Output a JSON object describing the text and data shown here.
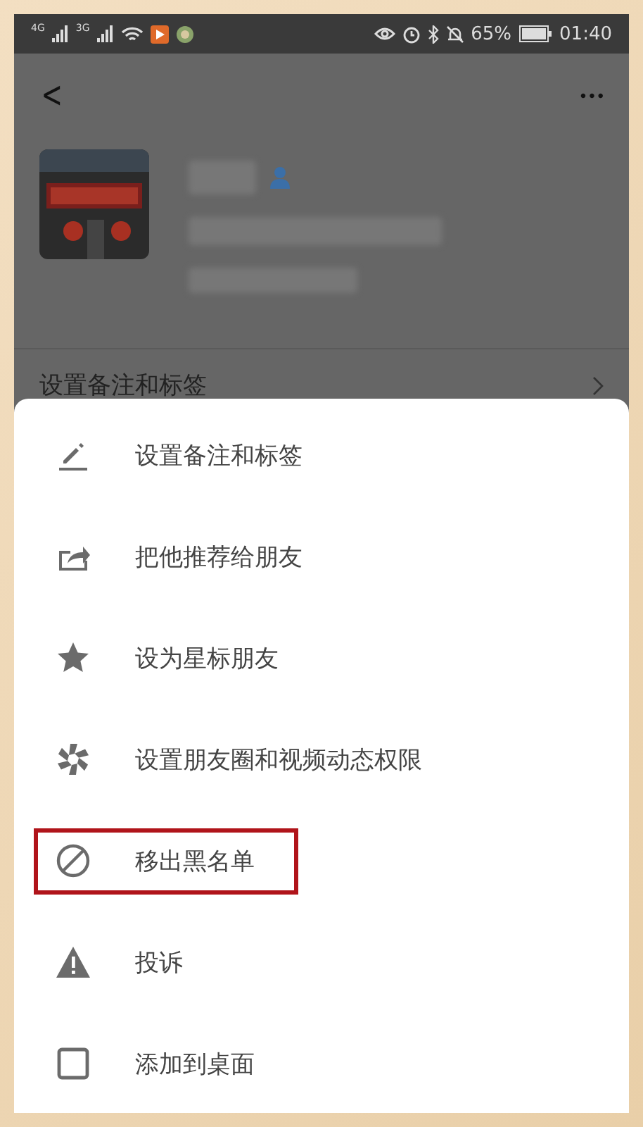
{
  "status_bar": {
    "network_1": "4G",
    "network_2": "3G",
    "battery": "65%",
    "time": "01:40"
  },
  "header": {
    "back": "<",
    "more": "•••"
  },
  "background_row": {
    "label": "设置备注和标签"
  },
  "menu": [
    {
      "kind": "edit",
      "label": "设置备注和标签",
      "highlighted": false
    },
    {
      "kind": "share",
      "label": "把他推荐给朋友",
      "highlighted": false
    },
    {
      "kind": "star",
      "label": "设为星标朋友",
      "highlighted": false
    },
    {
      "kind": "moments",
      "label": "设置朋友圈和视频动态权限",
      "highlighted": false
    },
    {
      "kind": "block",
      "label": "移出黑名单",
      "highlighted": true
    },
    {
      "kind": "warning",
      "label": "投诉",
      "highlighted": false
    },
    {
      "kind": "desktop",
      "label": "添加到桌面",
      "highlighted": false
    }
  ]
}
